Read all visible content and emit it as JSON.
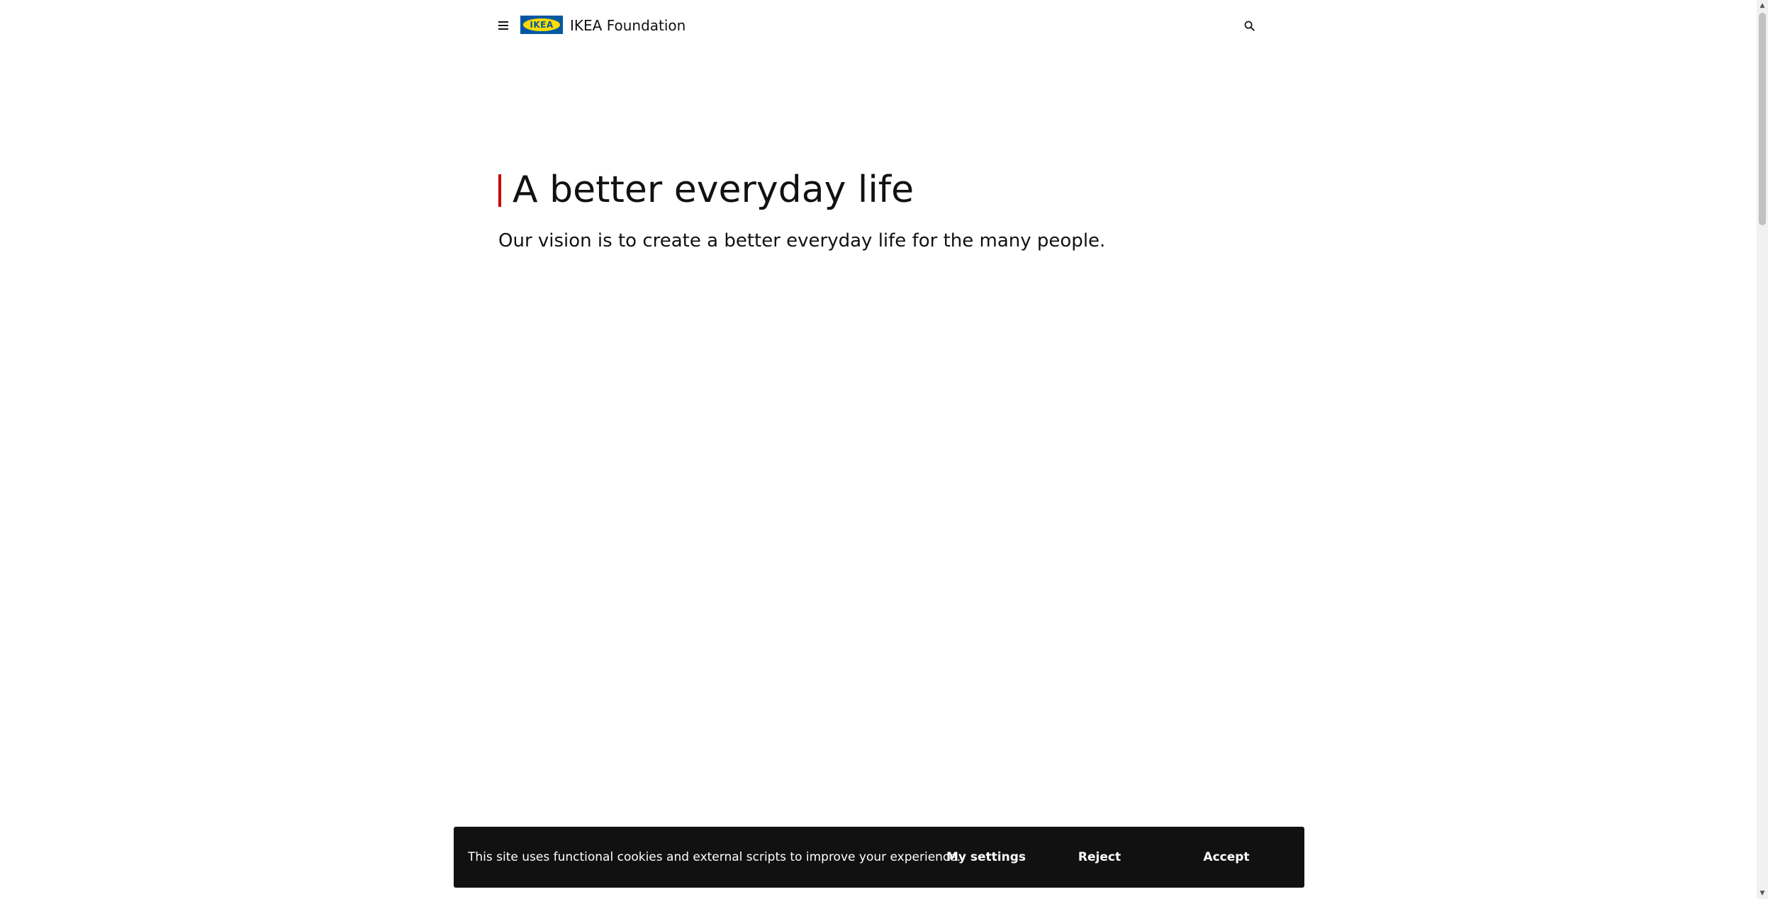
{
  "header": {
    "menu_icon": "hamburger-menu-icon",
    "logo_text": "IKEA",
    "site_name": "IKEA Foundation",
    "search_icon": "search-icon"
  },
  "hero": {
    "title": "A better everyday life",
    "text": "Our vision is to create a better everyday life for the many people."
  },
  "cookie_banner": {
    "message": "This site uses functional cookies and external scripts to improve your experience.",
    "settings_label": "My settings",
    "reject_label": "Reject",
    "accept_label": "Accept"
  },
  "colors": {
    "ikea_blue": "#0058a3",
    "ikea_yellow": "#ffdb00",
    "accent_red": "#cc0008",
    "banner_background": "#111111"
  }
}
